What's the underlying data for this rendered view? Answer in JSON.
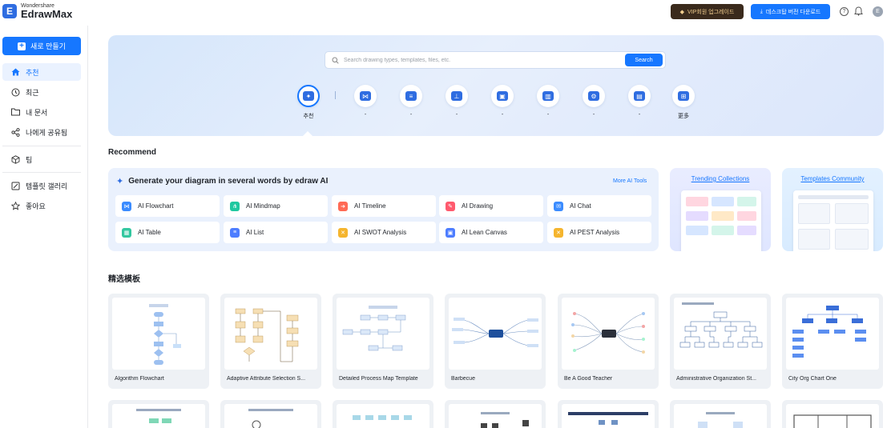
{
  "app": {
    "logo_small": "Wondershare",
    "logo_big": "EdrawMax",
    "logo_letter": "E"
  },
  "topbar": {
    "vip_label": "VIP회원 업그레이드",
    "download_label": "데스크탑 버전 다운로드",
    "help_icon": "question-circle-icon",
    "bell_icon": "bell-icon",
    "avatar_letter": "E"
  },
  "sidebar": {
    "new_label": "새로 만들기",
    "items": [
      {
        "label": "추천",
        "icon": "home-icon"
      },
      {
        "label": "최근",
        "icon": "clock-icon"
      },
      {
        "label": "내 문서",
        "icon": "folder-icon"
      },
      {
        "label": "나에게 공유됨",
        "icon": "share-icon"
      },
      {
        "label": "팀",
        "icon": "team-cube-icon"
      },
      {
        "label": "템플릿 갤러리",
        "icon": "template-gallery-icon"
      },
      {
        "label": "좋아요",
        "icon": "star-icon"
      }
    ]
  },
  "search": {
    "placeholder": "Search drawing types, templates, files, etc.",
    "button_label": "Search"
  },
  "categories": [
    {
      "label": "추천",
      "icon": "recommend-icon",
      "active": true
    },
    {
      "label": "-",
      "icon": "flowchart-icon"
    },
    {
      "label": "-",
      "icon": "list-icon"
    },
    {
      "label": "-",
      "icon": "orgchart-icon"
    },
    {
      "label": "-",
      "icon": "network-icon"
    },
    {
      "label": "-",
      "icon": "bar-chart-icon"
    },
    {
      "label": "-",
      "icon": "engineering-icon"
    },
    {
      "label": "-",
      "icon": "presentation-icon"
    },
    {
      "label": "更多",
      "icon": "more-grid-icon"
    }
  ],
  "recommend_title": "Recommend",
  "ai": {
    "heading": "Generate your diagram in several words by edraw AI",
    "more_label": "More AI Tools",
    "tools": [
      {
        "label": "AI Flowchart",
        "color": "#3b8cff"
      },
      {
        "label": "AI Mindmap",
        "color": "#1fc8a0"
      },
      {
        "label": "AI Timeline",
        "color": "#ff6a55"
      },
      {
        "label": "AI Drawing",
        "color": "#ff5a6e"
      },
      {
        "label": "AI Chat",
        "color": "#3b8cff"
      },
      {
        "label": "AI Table",
        "color": "#33c7a0"
      },
      {
        "label": "AI List",
        "color": "#4d7dff"
      },
      {
        "label": "AI SWOT Analysis",
        "color": "#f5b52e"
      },
      {
        "label": "AI Lean Canvas",
        "color": "#4d7dff"
      },
      {
        "label": "AI PEST Analysis",
        "color": "#f5b52e"
      }
    ]
  },
  "promos": [
    {
      "title": "Trending Collections"
    },
    {
      "title": "Templates Community"
    }
  ],
  "templates_title": "精选模板",
  "templates": [
    {
      "name": "Algorithm Flowchart",
      "kind": "flow"
    },
    {
      "name": "Adaptive Attribute Selection S...",
      "kind": "flow2"
    },
    {
      "name": "Detailed Process Map Template",
      "kind": "process"
    },
    {
      "name": "Barbecue",
      "kind": "mind"
    },
    {
      "name": "Be A Good Teacher",
      "kind": "mind2"
    },
    {
      "name": "Administrative Organization St...",
      "kind": "org"
    },
    {
      "name": "City Org Chart One",
      "kind": "org2"
    }
  ]
}
